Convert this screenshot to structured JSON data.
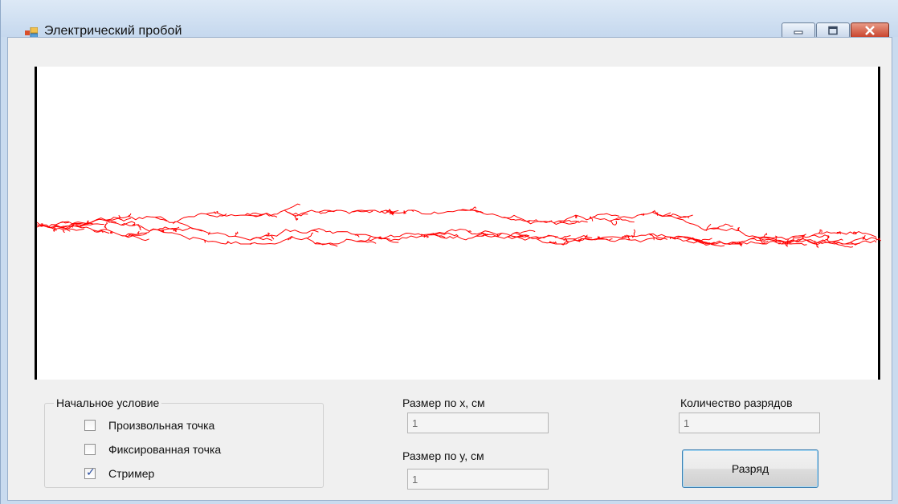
{
  "window": {
    "title": "Электрический пробой",
    "buttons": {
      "minimize": "minimize-icon",
      "maximize": "maximize-icon",
      "close": "close-icon"
    }
  },
  "canvas": {
    "background": "#ffffff",
    "electrode_color": "#000000",
    "discharge_color": "#ff0000"
  },
  "initial_condition": {
    "legend": "Начальное условие",
    "options": [
      {
        "label": "Произвольная точка",
        "checked": false
      },
      {
        "label": "Фиксированная точка",
        "checked": false
      },
      {
        "label": "Стример",
        "checked": true
      }
    ]
  },
  "size_x": {
    "label": "Размер по x, см",
    "value": "1"
  },
  "size_y": {
    "label": "Размер по y, см",
    "value": "1"
  },
  "discharge_count": {
    "label": "Количество разрядов",
    "value": "1"
  },
  "discharge_button": {
    "label": "Разряд"
  }
}
